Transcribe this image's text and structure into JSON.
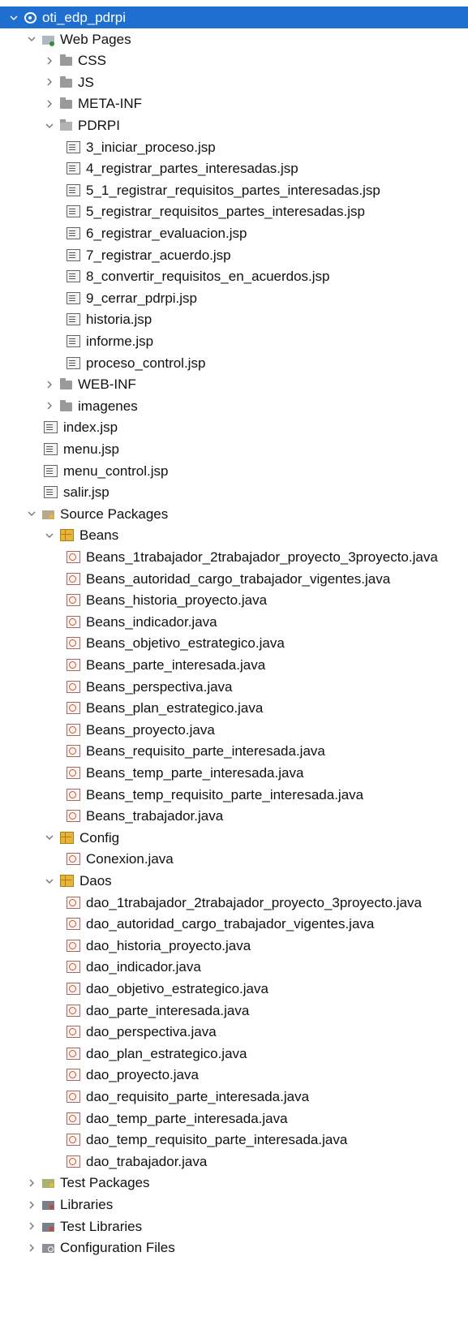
{
  "tree": {
    "project": "oti_edp_pdrpi",
    "web_pages": {
      "label": "Web Pages",
      "folders": [
        "CSS",
        "JS",
        "META-INF"
      ],
      "pdrpi": {
        "label": "PDRPI",
        "files": [
          "3_iniciar_proceso.jsp",
          "4_registrar_partes_interesadas.jsp",
          "5_1_registrar_requisitos_partes_interesadas.jsp",
          "5_registrar_requisitos_partes_interesadas.jsp",
          "6_registrar_evaluacion.jsp",
          "7_registrar_acuerdo.jsp",
          "8_convertir_requisitos_en_acuerdos.jsp",
          "9_cerrar_pdrpi.jsp",
          "historia.jsp",
          "informe.jsp",
          "proceso_control.jsp"
        ]
      },
      "folders_after": [
        "WEB-INF",
        "imagenes"
      ],
      "files": [
        "index.jsp",
        "menu.jsp",
        "menu_control.jsp",
        "salir.jsp"
      ]
    },
    "source_packages": {
      "label": "Source Packages",
      "beans": {
        "label": "Beans",
        "files": [
          "Beans_1trabajador_2trabajador_proyecto_3proyecto.java",
          "Beans_autoridad_cargo_trabajador_vigentes.java",
          "Beans_historia_proyecto.java",
          "Beans_indicador.java",
          "Beans_objetivo_estrategico.java",
          "Beans_parte_interesada.java",
          "Beans_perspectiva.java",
          "Beans_plan_estrategico.java",
          "Beans_proyecto.java",
          "Beans_requisito_parte_interesada.java",
          "Beans_temp_parte_interesada.java",
          "Beans_temp_requisito_parte_interesada.java",
          "Beans_trabajador.java"
        ]
      },
      "config": {
        "label": "Config",
        "files": [
          "Conexion.java"
        ]
      },
      "daos": {
        "label": "Daos",
        "files": [
          "dao_1trabajador_2trabajador_proyecto_3proyecto.java",
          "dao_autoridad_cargo_trabajador_vigentes.java",
          "dao_historia_proyecto.java",
          "dao_indicador.java",
          "dao_objetivo_estrategico.java",
          "dao_parte_interesada.java",
          "dao_perspectiva.java",
          "dao_plan_estrategico.java",
          "dao_proyecto.java",
          "dao_requisito_parte_interesada.java",
          "dao_temp_parte_interesada.java",
          "dao_temp_requisito_parte_interesada.java",
          "dao_trabajador.java"
        ]
      }
    },
    "bottom_nodes": [
      "Test Packages",
      "Libraries",
      "Test Libraries",
      "Configuration Files"
    ]
  },
  "colors": {
    "selection": "#1f6fd1"
  }
}
